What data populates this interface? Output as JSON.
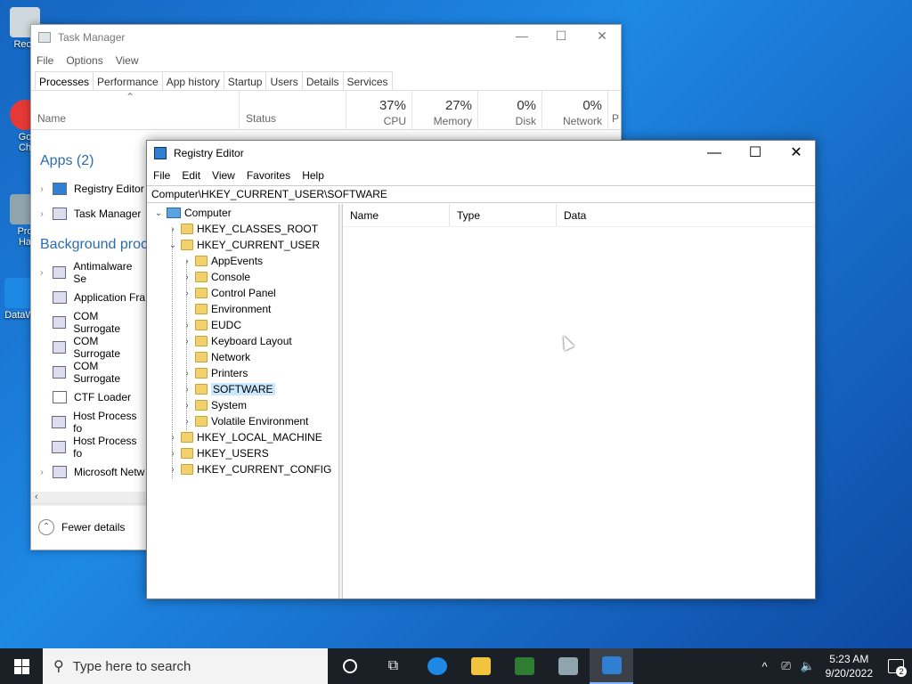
{
  "desktop": {
    "icons": [
      {
        "label": "Recy",
        "color": "#cfd8dc"
      },
      {
        "label": "Go\nCh",
        "color": "#e53935"
      },
      {
        "label": "Pro\nHa",
        "color": "#90a4ae"
      },
      {
        "label": "DataW",
        "color": "#1e88e5"
      }
    ]
  },
  "task_manager": {
    "title": "Task Manager",
    "controls": [
      "—",
      "☐",
      "✕"
    ],
    "menu": [
      "File",
      "Options",
      "View"
    ],
    "tabs": [
      "Processes",
      "Performance",
      "App history",
      "Startup",
      "Users",
      "Details",
      "Services"
    ],
    "columns": {
      "name": "Name",
      "status": "Status",
      "cpu": {
        "pct": "37%",
        "label": "CPU"
      },
      "memory": {
        "pct": "27%",
        "label": "Memory"
      },
      "disk": {
        "pct": "0%",
        "label": "Disk"
      },
      "network": {
        "pct": "0%",
        "label": "Network"
      },
      "p": "P"
    },
    "groups": {
      "apps": "Apps (2)",
      "background": "Background proc"
    },
    "apps": [
      "Registry Editor",
      "Task Manager"
    ],
    "background": [
      "Antimalware Se",
      "Application Fra",
      "COM Surrogate",
      "COM Surrogate",
      "COM Surrogate",
      "CTF Loader",
      "Host Process fo",
      "Host Process fo",
      "Microsoft Netw"
    ],
    "fewer_details": "Fewer details"
  },
  "registry_editor": {
    "title": "Registry Editor",
    "controls": [
      "—",
      "☐",
      "✕"
    ],
    "menu": [
      "File",
      "Edit",
      "View",
      "Favorites",
      "Help"
    ],
    "address": "Computer\\HKEY_CURRENT_USER\\SOFTWARE",
    "tree": {
      "root": "Computer",
      "hives": [
        "HKEY_CLASSES_ROOT",
        "HKEY_CURRENT_USER",
        "HKEY_LOCAL_MACHINE",
        "HKEY_USERS",
        "HKEY_CURRENT_CONFIG"
      ],
      "hkcu_children": [
        "AppEvents",
        "Console",
        "Control Panel",
        "Environment",
        "EUDC",
        "Keyboard Layout",
        "Network",
        "Printers",
        "SOFTWARE",
        "System",
        "Volatile Environment"
      ],
      "selected": "SOFTWARE"
    },
    "list_columns": [
      "Name",
      "Type",
      "Data"
    ]
  },
  "taskbar": {
    "search_placeholder": "Type here to search",
    "time": "5:23 AM",
    "date": "9/20/2022",
    "notification_count": "2",
    "tray_icons": [
      "^",
      "⎚",
      "🔈"
    ],
    "apps": [
      {
        "name": "task-view",
        "color": "#ffffff"
      },
      {
        "name": "edge",
        "color": "#1e88e5"
      },
      {
        "name": "file-explorer",
        "color": "#f2c33d"
      },
      {
        "name": "store",
        "color": "#2e7d32"
      },
      {
        "name": "task-manager",
        "color": "#90a4ae"
      },
      {
        "name": "registry-editor",
        "color": "#2f7fd3"
      }
    ]
  }
}
